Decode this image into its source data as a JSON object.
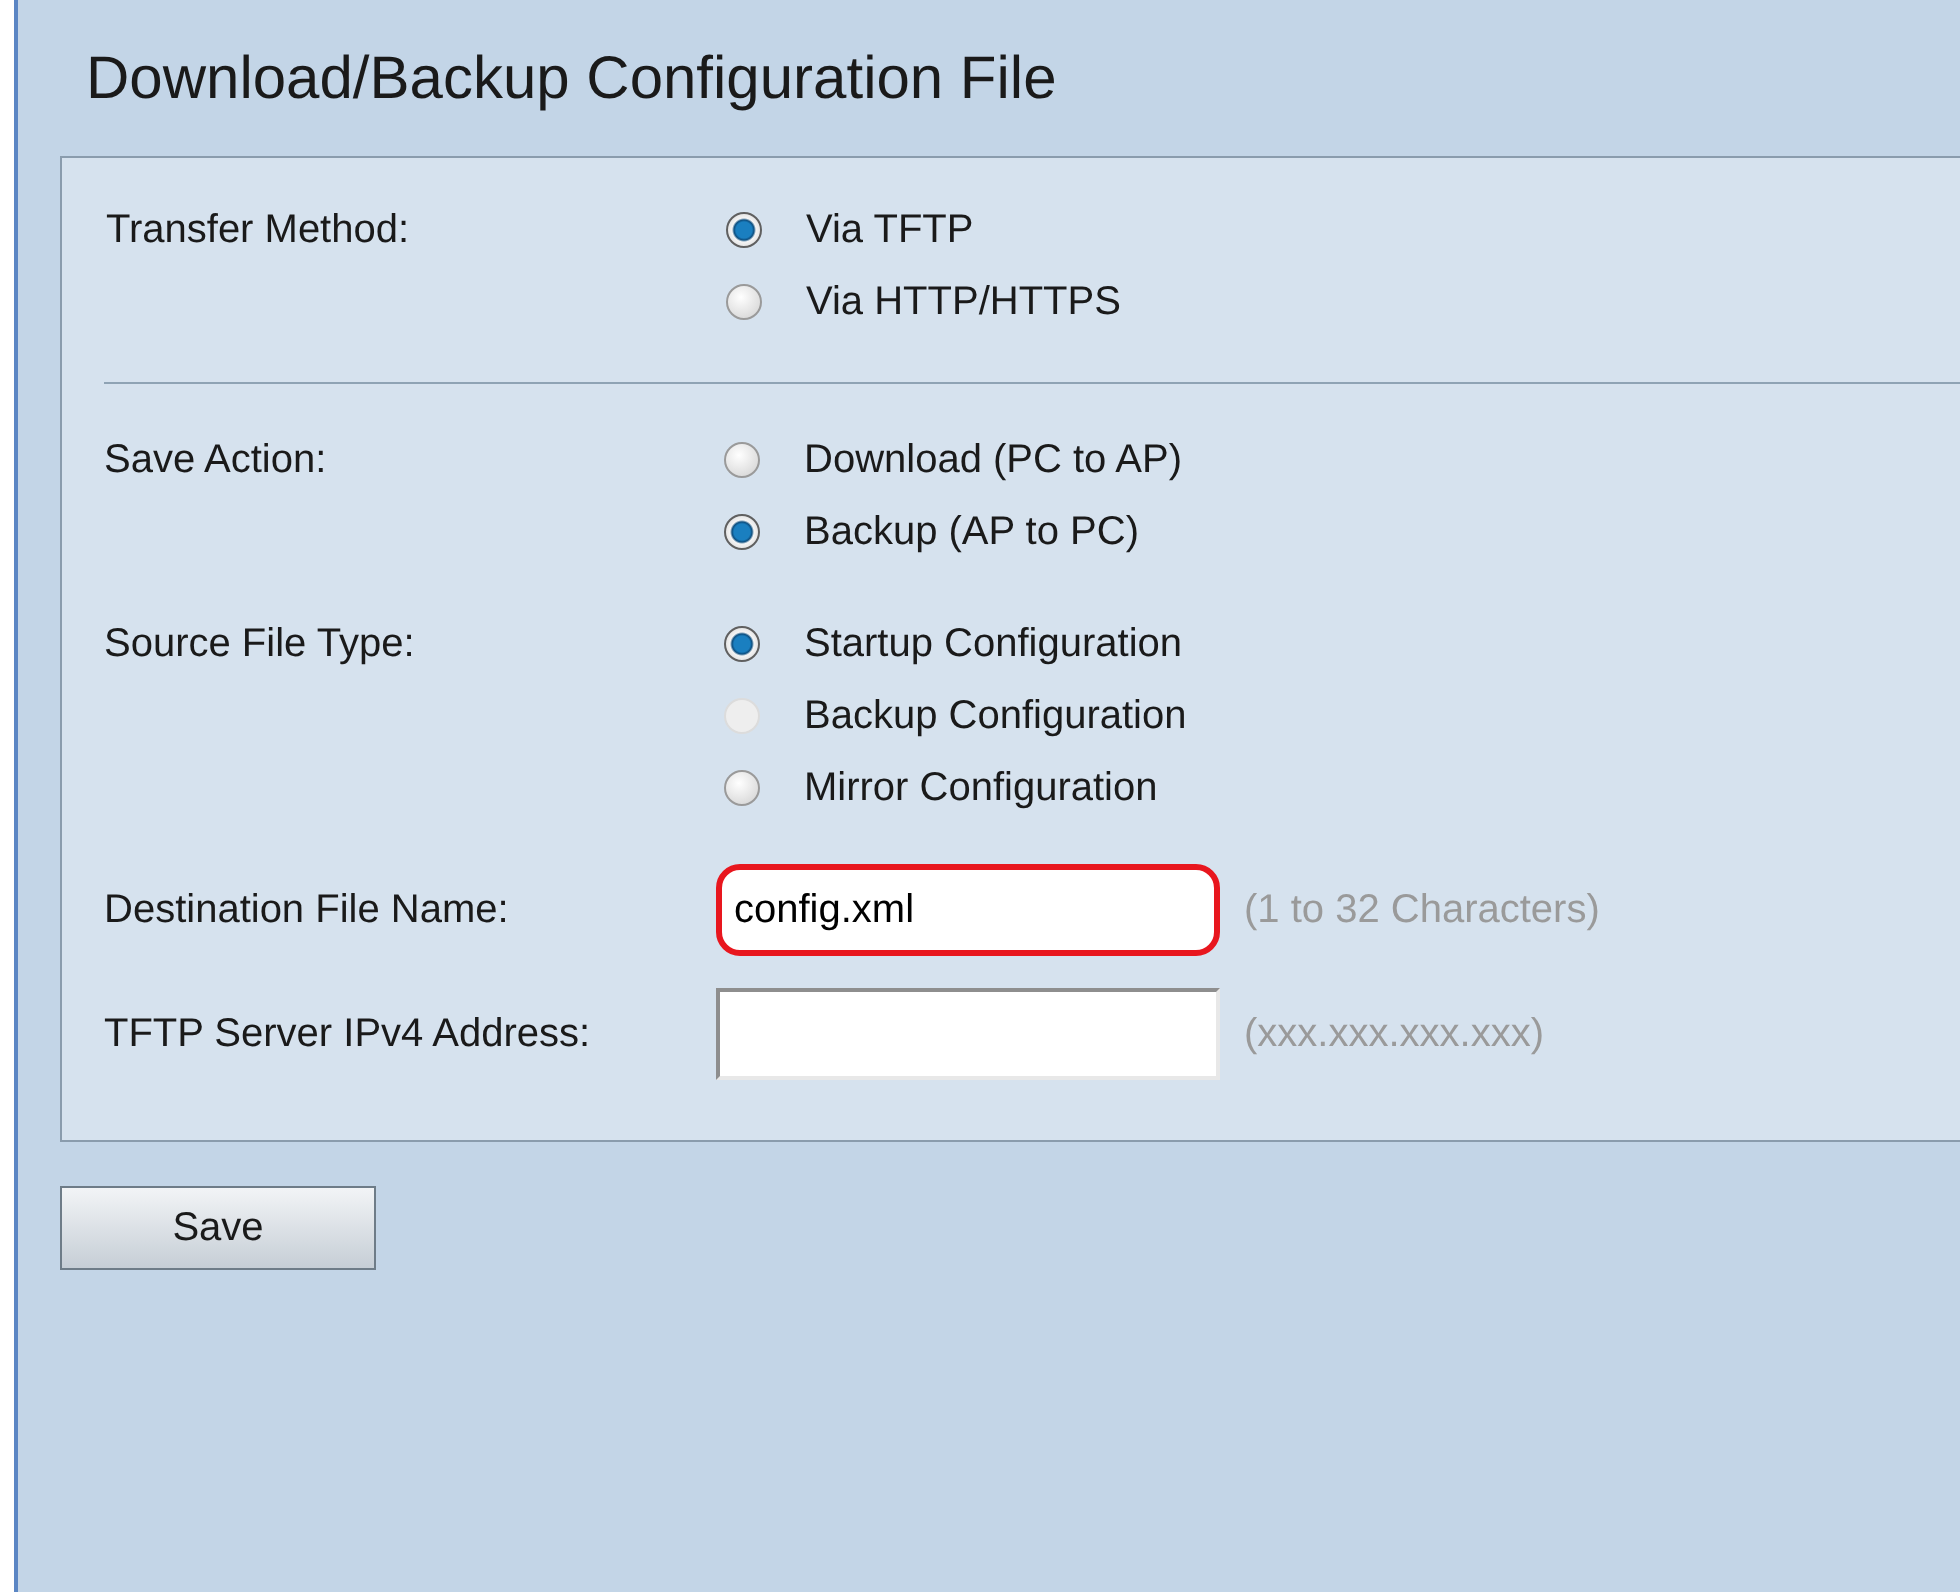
{
  "title": "Download/Backup Configuration File",
  "sections": [
    {
      "fields": [
        {
          "kind": "radio",
          "label": "Transfer Method:",
          "options": [
            {
              "label": "Via TFTP",
              "selected": true,
              "disabled": false
            },
            {
              "label": "Via HTTP/HTTPS",
              "selected": false,
              "disabled": false
            }
          ]
        }
      ]
    },
    {
      "fields": [
        {
          "kind": "radio",
          "label": "Save Action:",
          "options": [
            {
              "label": "Download (PC to AP)",
              "selected": false,
              "disabled": false
            },
            {
              "label": "Backup (AP to PC)",
              "selected": true,
              "disabled": false
            }
          ]
        },
        {
          "kind": "radio",
          "label": "Source File Type:",
          "options": [
            {
              "label": "Startup Configuration",
              "selected": true,
              "disabled": false
            },
            {
              "label": "Backup Configuration",
              "selected": false,
              "disabled": true
            },
            {
              "label": "Mirror Configuration",
              "selected": false,
              "disabled": false
            }
          ]
        },
        {
          "kind": "text",
          "label": "Destination File Name:",
          "value": "config.xml",
          "hint": "(1 to 32 Characters)",
          "highlighted": true
        },
        {
          "kind": "text",
          "label": "TFTP Server IPv4 Address:",
          "hint": "(xxx.xxx.xxx.xxx)",
          "highlighted": false
        }
      ]
    }
  ],
  "save_button": "Save"
}
